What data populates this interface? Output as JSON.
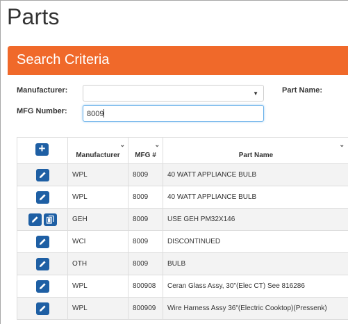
{
  "page": {
    "title": "Parts"
  },
  "search": {
    "panel_title": "Search Criteria",
    "manufacturer_label": "Manufacturer:",
    "manufacturer_value": "",
    "part_name_label": "Part Name:",
    "mfg_number_label": "MFG Number:",
    "mfg_number_value": "8009"
  },
  "grid": {
    "columns": [
      "",
      "Manufacturer",
      "MFG #",
      "Part Name"
    ],
    "rows": [
      {
        "manufacturer": "WPL",
        "mfg": "8009",
        "part_name": "40 WATT APPLIANCE BULB",
        "has_copy": false
      },
      {
        "manufacturer": "WPL",
        "mfg": "8009",
        "part_name": "40 WATT APPLIANCE BULB",
        "has_copy": false
      },
      {
        "manufacturer": "GEH",
        "mfg": "8009",
        "part_name": "USE GEH PM32X146",
        "has_copy": true
      },
      {
        "manufacturer": "WCI",
        "mfg": "8009",
        "part_name": "DISCONTINUED",
        "has_copy": false
      },
      {
        "manufacturer": "OTH",
        "mfg": "8009",
        "part_name": "BULB",
        "has_copy": false
      },
      {
        "manufacturer": "WPL",
        "mfg": "800908",
        "part_name": "Ceran Glass Assy, 30\"(Elec CT) See 816286",
        "has_copy": false
      },
      {
        "manufacturer": "WPL",
        "mfg": "800909",
        "part_name": "Wire Harness Assy 36\"(Electric Cooktop)(Pressenk)",
        "has_copy": false
      }
    ]
  },
  "colors": {
    "accent": "#f0692a",
    "button": "#1e5fa4"
  },
  "icons": {
    "add": "plus-icon",
    "edit": "pencil-icon",
    "copy": "copy-icon",
    "sort": "chevron-down-icon"
  }
}
